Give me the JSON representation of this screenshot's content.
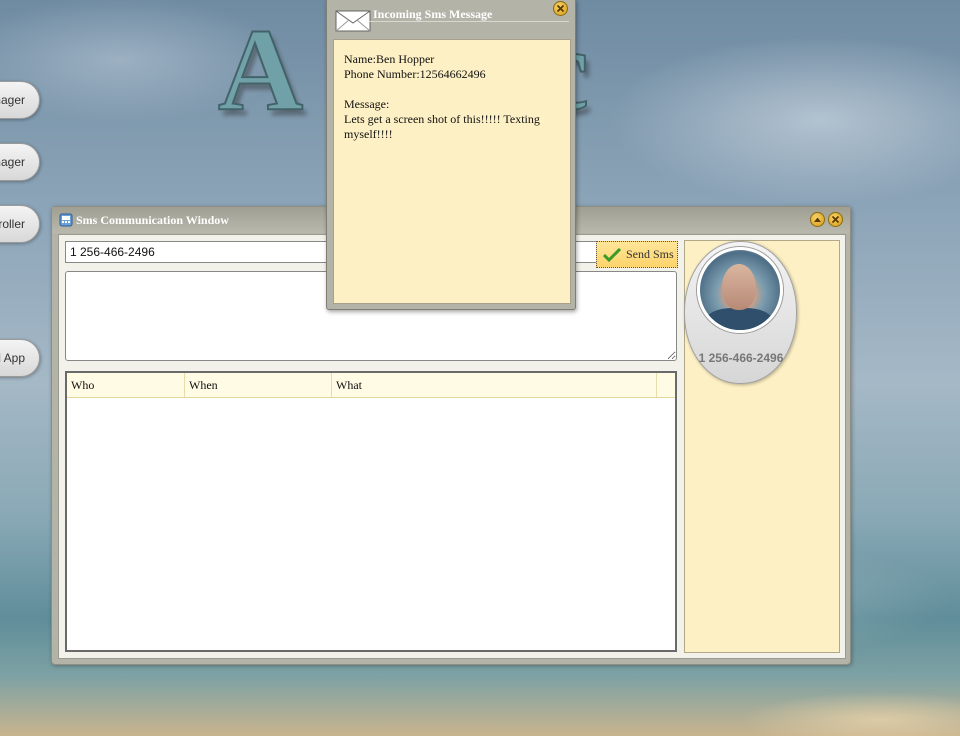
{
  "desktop": {
    "title": "Ar      nc",
    "side_buttons": [
      {
        "label": "nager"
      },
      {
        "label": "nager"
      },
      {
        "label": "roller"
      },
      {
        "label": "l App"
      }
    ]
  },
  "sms_window": {
    "title": "Sms Communication Window",
    "phone_value": "1 256-466-2496",
    "send_label": "Send Sms",
    "columns": [
      "Who",
      "When",
      "What"
    ],
    "contact_number": "1 256-466-2496"
  },
  "popup": {
    "title": "Incoming Sms Message",
    "name_line": "Name:Ben Hopper",
    "phone_line": "Phone Number:12564662496",
    "message_label": "Message:",
    "message_text": "Lets get a screen shot of this!!!!! Texting myself!!!!"
  }
}
